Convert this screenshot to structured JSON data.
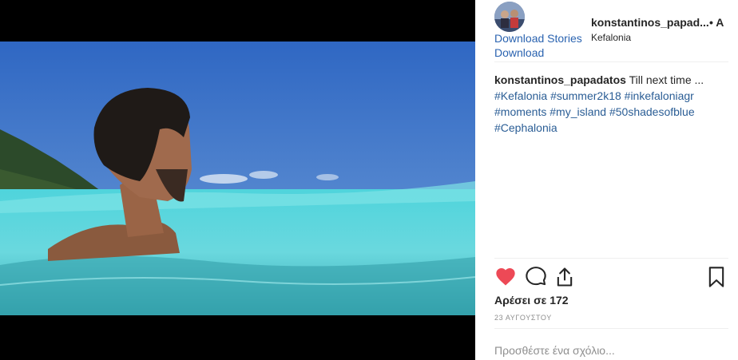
{
  "post": {
    "username": "konstantinos_papad...",
    "follow_marker": "• A",
    "location": "Kefalonia",
    "download_stories": "Download Stories",
    "download": "Download",
    "caption_user": "konstantinos_papadatos",
    "caption_text": "Till next time ...",
    "hashtags": [
      "#Kefalonia",
      "#summer2k18",
      "#inkefaloniagr",
      "#moments",
      "#my_island",
      "#50shadesofblue",
      "#Cephalonia"
    ],
    "likes": "Αρέσει σε 172",
    "date": "23 ΑΥΓΟΥΣΤΟΥ",
    "comment_placeholder": "Προσθέστε ένα σχόλιο...",
    "heart_color": "#ed4956"
  },
  "icons": {
    "like": "heart-icon",
    "comment": "comment-icon",
    "share": "share-icon",
    "save": "bookmark-icon"
  }
}
